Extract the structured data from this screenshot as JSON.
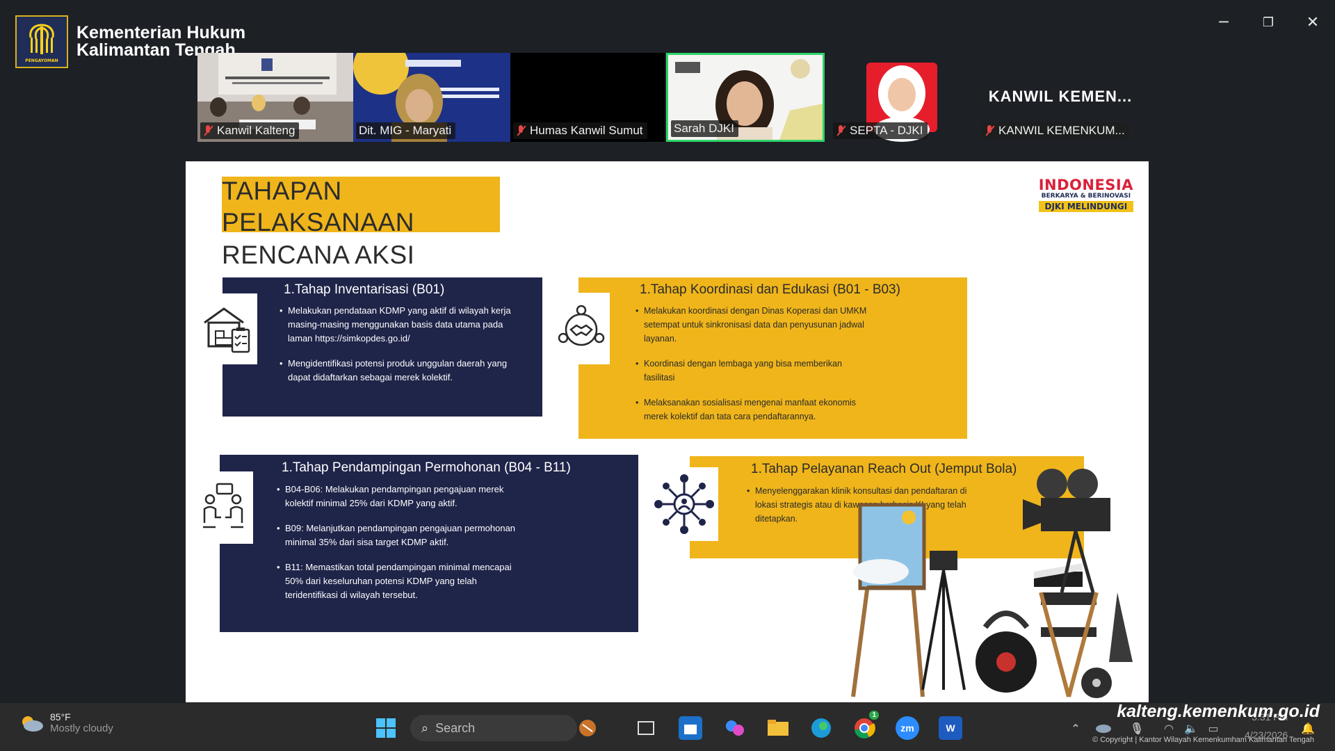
{
  "brand": {
    "line1": "Kementerian Hukum",
    "line2": "Kalimantan Tengah",
    "logo_text": "PENGAYOMAN"
  },
  "window_controls": {
    "minimize": "─",
    "restore": "❐",
    "close": "✕"
  },
  "participants": [
    {
      "name": "Kanwil Kalteng",
      "muted": true
    },
    {
      "name": "Dit. MIG - Maryati",
      "muted": false
    },
    {
      "name": "Humas Kanwil Sumut",
      "muted": true
    },
    {
      "name": "Sarah DJKI",
      "muted": false,
      "speaking": true
    },
    {
      "name": "SEPTA - DJKI",
      "muted": true
    },
    {
      "name": "KANWIL KEMENKUM...",
      "muted": true,
      "big_label": "KANWIL KEMEN..."
    }
  ],
  "slide": {
    "title_l1": "TAHAPAN",
    "title_l2": "PELAKSANAAN",
    "title_l3": "RENCANA AKSI",
    "badge": {
      "line1": "INDONESIA",
      "line2": "BERKARYA & BERINOVASI",
      "line3": "DJKI MELINDUNGI"
    },
    "cards": [
      {
        "title": "1.Tahap Inventarisasi (B01)",
        "icon": "warehouse-checklist-icon",
        "bullets": [
          "Melakukan pendataan KDMP yang aktif di wilayah kerja masing-masing menggunakan basis data utama pada laman https://simkopdes.go.id/",
          "Mengidentifikasi potensi produk unggulan daerah yang dapat didaftarkan sebagai merek kolektif."
        ]
      },
      {
        "title": "1.Tahap Koordinasi dan Edukasi (B01 - B03)",
        "icon": "handshake-network-icon",
        "bullets": [
          "Melakukan koordinasi dengan Dinas Koperasi dan UMKM setempat untuk sinkronisasi data dan penyusunan jadwal layanan.",
          "Koordinasi dengan lembaga yang bisa memberikan fasilitasi",
          "Melaksanakan sosialisasi mengenai manfaat ekonomis merek kolektif dan tata cara pendaftarannya."
        ]
      },
      {
        "title": "1.Tahap Pendampingan Permohonan (B04 - B11)",
        "icon": "consultation-people-icon",
        "bullets": [
          "B04-B06: Melakukan pendampingan pengajuan merek kolektif minimal 25% dari KDMP yang aktif.",
          "B09: Melanjutkan pendampingan pengajuan permohonan minimal 35% dari sisa target KDMP aktif.",
          "B11: Memastikan total pendampingan minimal mencapai 50% dari keseluruhan potensi KDMP yang telah teridentifikasi di wilayah tersebut."
        ]
      },
      {
        "title": "1.Tahap Pelayanan Reach Out (Jemput Bola)",
        "icon": "network-hub-icon",
        "bullets": [
          "Menyelenggarakan klinik konsultasi dan pendaftaran di lokasi strategis atau di kawasan berbasis KI yang telah ditetapkan."
        ]
      }
    ]
  },
  "taskbar": {
    "weather_temp": "85°F",
    "weather_desc": "Mostly cloudy",
    "search_placeholder": "Search",
    "apps": [
      "windows-start-icon",
      "copilot-icon",
      "task-view-icon",
      "store-icon",
      "copilot-app-icon",
      "file-explorer-icon",
      "edge-icon",
      "chrome-icon",
      "zoom-icon",
      "word-icon"
    ],
    "zoom_label": "zm",
    "word_label": "W",
    "chrome_badge": "1",
    "clock_time": "3:31 PM",
    "clock_date": "4/23/2026"
  },
  "overlay": {
    "url": "kalteng.kemenkum.go.id",
    "copyright": "© Copyright | Kantor Wilayah Kemenkumham Kalimantan Tengah"
  },
  "colors": {
    "navy": "#1f2449",
    "gold": "#efb51b",
    "red": "#d9223a",
    "speaking_border": "#2fd46a"
  }
}
